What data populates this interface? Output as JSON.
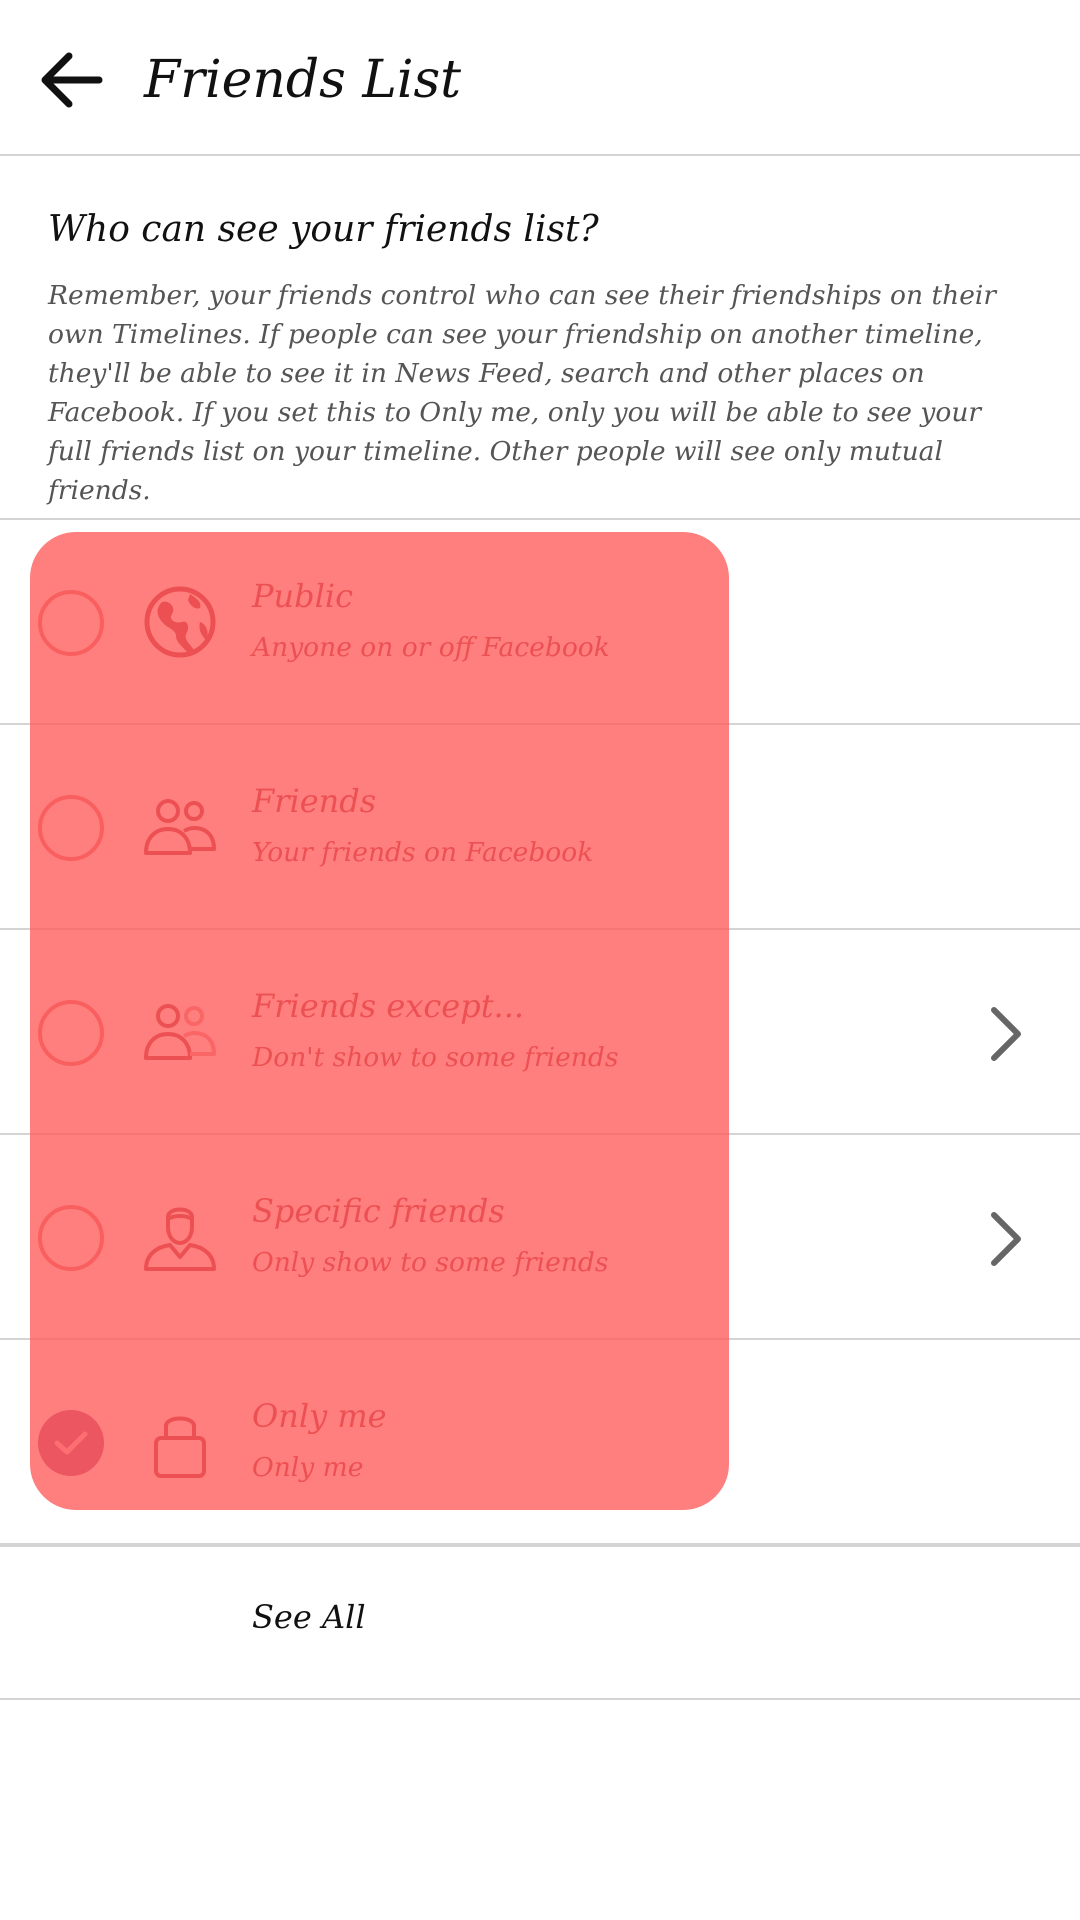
{
  "header": {
    "title": "Friends List",
    "back_icon": "arrow-left-icon"
  },
  "intro": {
    "title": "Who can see your friends list?",
    "description": "Remember, your friends control who can see their friendships on their own Timelines. If people can see your friendship on another timeline, they'll be able to see it in News Feed, search and other places on Facebook. If you set this to Only me, only you will be able to see your full friends list on your timeline. Other people will see only mutual friends."
  },
  "options": [
    {
      "label": "Public",
      "sublabel": "Anyone on or off Facebook",
      "icon": "globe-icon",
      "selected": false,
      "has_chevron": false
    },
    {
      "label": "Friends",
      "sublabel": "Your friends on Facebook",
      "icon": "friends-icon",
      "selected": false,
      "has_chevron": false
    },
    {
      "label": "Friends except...",
      "sublabel": "Don't show to some friends",
      "icon": "friends-except-icon",
      "selected": false,
      "has_chevron": true
    },
    {
      "label": "Specific friends",
      "sublabel": "Only show to some friends",
      "icon": "person-icon",
      "selected": false,
      "has_chevron": true
    },
    {
      "label": "Only me",
      "sublabel": "Only me",
      "icon": "lock-icon",
      "selected": true,
      "has_chevron": false
    }
  ],
  "footer": {
    "see_all_label": "See All"
  },
  "colors": {
    "overlay": "#ff5a5a",
    "selected_radio": "#a44a7c",
    "option_text": "#a83038",
    "divider": "#d4d4d4"
  }
}
